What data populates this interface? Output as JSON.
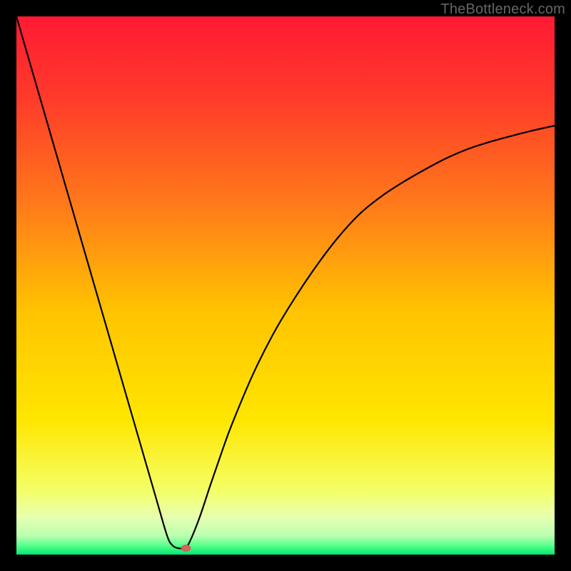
{
  "attribution": "TheBottleneck.com",
  "chart_data": {
    "type": "line",
    "title": "",
    "xlabel": "",
    "ylabel": "",
    "xlim": [
      0,
      1
    ],
    "ylim": [
      0,
      1
    ],
    "x": [
      0.0,
      0.02,
      0.04,
      0.06,
      0.08,
      0.1,
      0.12,
      0.14,
      0.16,
      0.18,
      0.2,
      0.22,
      0.24,
      0.26,
      0.28,
      0.29,
      0.3,
      0.31,
      0.32,
      0.34,
      0.36,
      0.38,
      0.4,
      0.44,
      0.48,
      0.52,
      0.56,
      0.6,
      0.64,
      0.68,
      0.72,
      0.76,
      0.8,
      0.84,
      0.88,
      0.92,
      0.96,
      1.0
    ],
    "values": [
      1.0,
      0.931,
      0.862,
      0.793,
      0.724,
      0.655,
      0.586,
      0.517,
      0.448,
      0.379,
      0.31,
      0.241,
      0.172,
      0.103,
      0.035,
      0.017,
      0.012,
      0.012,
      0.02,
      0.068,
      0.128,
      0.186,
      0.241,
      0.336,
      0.415,
      0.481,
      0.54,
      0.592,
      0.635,
      0.667,
      0.693,
      0.716,
      0.737,
      0.754,
      0.767,
      0.778,
      0.788,
      0.797
    ],
    "vertex_x": 0.305,
    "marker": {
      "x": 0.315,
      "y": 0.012,
      "color": "#c96a5a"
    },
    "gradient_stops": [
      {
        "offset": 0.0,
        "color": "#ff1a33"
      },
      {
        "offset": 0.15,
        "color": "#ff3a2a"
      },
      {
        "offset": 0.35,
        "color": "#ff7a1a"
      },
      {
        "offset": 0.55,
        "color": "#ffc400"
      },
      {
        "offset": 0.75,
        "color": "#ffe600"
      },
      {
        "offset": 0.88,
        "color": "#f4ff66"
      },
      {
        "offset": 0.93,
        "color": "#e8ffb0"
      },
      {
        "offset": 0.965,
        "color": "#baffb0"
      },
      {
        "offset": 0.985,
        "color": "#4dff88"
      },
      {
        "offset": 1.0,
        "color": "#00e673"
      }
    ]
  }
}
